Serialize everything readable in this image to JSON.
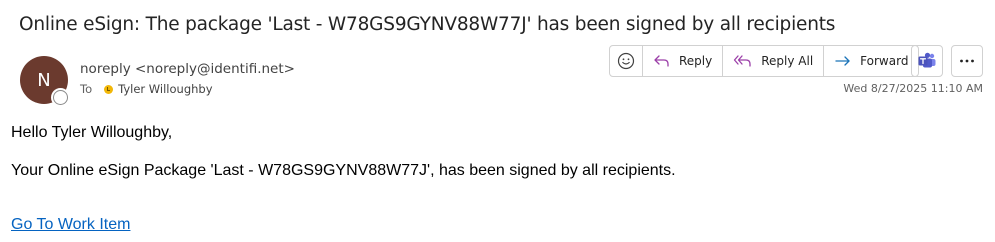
{
  "email": {
    "subject": "Online eSign: The package 'Last - W78GS9GYNV88W77J' has been signed by all recipients",
    "sender": {
      "avatar_initial": "N",
      "display": "noreply <noreply@identifi.net>",
      "avatar_color": "#6b3a2e"
    },
    "to": {
      "label": "To",
      "recipient": "Tyler Willoughby"
    },
    "date": "Wed 8/27/2025 11:10 AM",
    "body": {
      "greeting": "Hello Tyler Willoughby,",
      "message": "Your Online eSign Package 'Last - W78GS9GYNV88W77J', has been signed by all recipients.",
      "link_text": "Go To Work Item"
    }
  },
  "actions": {
    "emoji_icon": "emoji-icon",
    "reply_label": "Reply",
    "reply_all_label": "Reply All",
    "forward_label": "Forward",
    "teams_icon": "teams-icon",
    "more_icon": "more-options-icon"
  },
  "colors": {
    "accent": "#5b5fc7",
    "link": "#0563c1",
    "teams": "#5059c9"
  }
}
